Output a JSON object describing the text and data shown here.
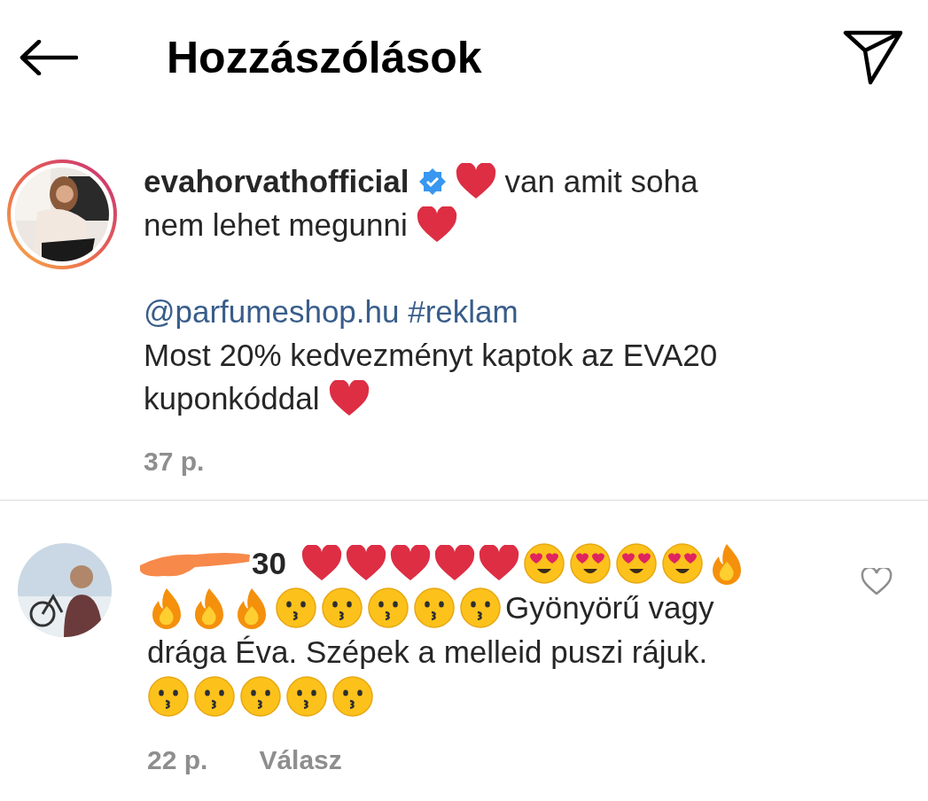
{
  "header": {
    "title": "Hozzászólások"
  },
  "post": {
    "username": "evahorvathofficial",
    "verified": true,
    "time": "37 p.",
    "paragraphs": [
      [
        [
          {
            "kind": "heart"
          },
          {
            "kind": "text",
            "text": "van amit soha"
          }
        ],
        [
          {
            "kind": "text",
            "text": "nem lehet megunni"
          },
          {
            "kind": "heart"
          }
        ]
      ],
      [
        [
          {
            "kind": "link",
            "text": "@parfumeshop.hu #reklam"
          }
        ],
        [
          {
            "kind": "text",
            "text": "Most 20% kedvezményt kaptok az EVA20"
          }
        ],
        [
          {
            "kind": "text",
            "text": "kuponkóddal"
          },
          {
            "kind": "heart"
          }
        ]
      ]
    ]
  },
  "comment": {
    "username": "30",
    "redacted": true,
    "liked": false,
    "time": "22 p.",
    "reply": "Válasz",
    "lines": [
      [
        {
          "kind": "heart"
        },
        {
          "kind": "heart"
        },
        {
          "kind": "heart"
        },
        {
          "kind": "heart"
        },
        {
          "kind": "heart"
        },
        {
          "kind": "heart_eyes"
        },
        {
          "kind": "heart_eyes"
        },
        {
          "kind": "heart_eyes"
        },
        {
          "kind": "heart_eyes"
        },
        {
          "kind": "fire"
        }
      ],
      [
        {
          "kind": "fire"
        },
        {
          "kind": "fire"
        },
        {
          "kind": "fire"
        },
        {
          "kind": "kiss"
        },
        {
          "kind": "kiss"
        },
        {
          "kind": "kiss"
        },
        {
          "kind": "kiss"
        },
        {
          "kind": "kiss"
        },
        {
          "kind": "text",
          "text": "Gyönyörű vagy"
        }
      ],
      [
        {
          "kind": "text",
          "text": "drága Éva. Szépek a melleid puszi rájuk."
        }
      ],
      [
        {
          "kind": "kiss"
        },
        {
          "kind": "kiss"
        },
        {
          "kind": "kiss"
        },
        {
          "kind": "kiss"
        },
        {
          "kind": "kiss"
        }
      ]
    ]
  }
}
